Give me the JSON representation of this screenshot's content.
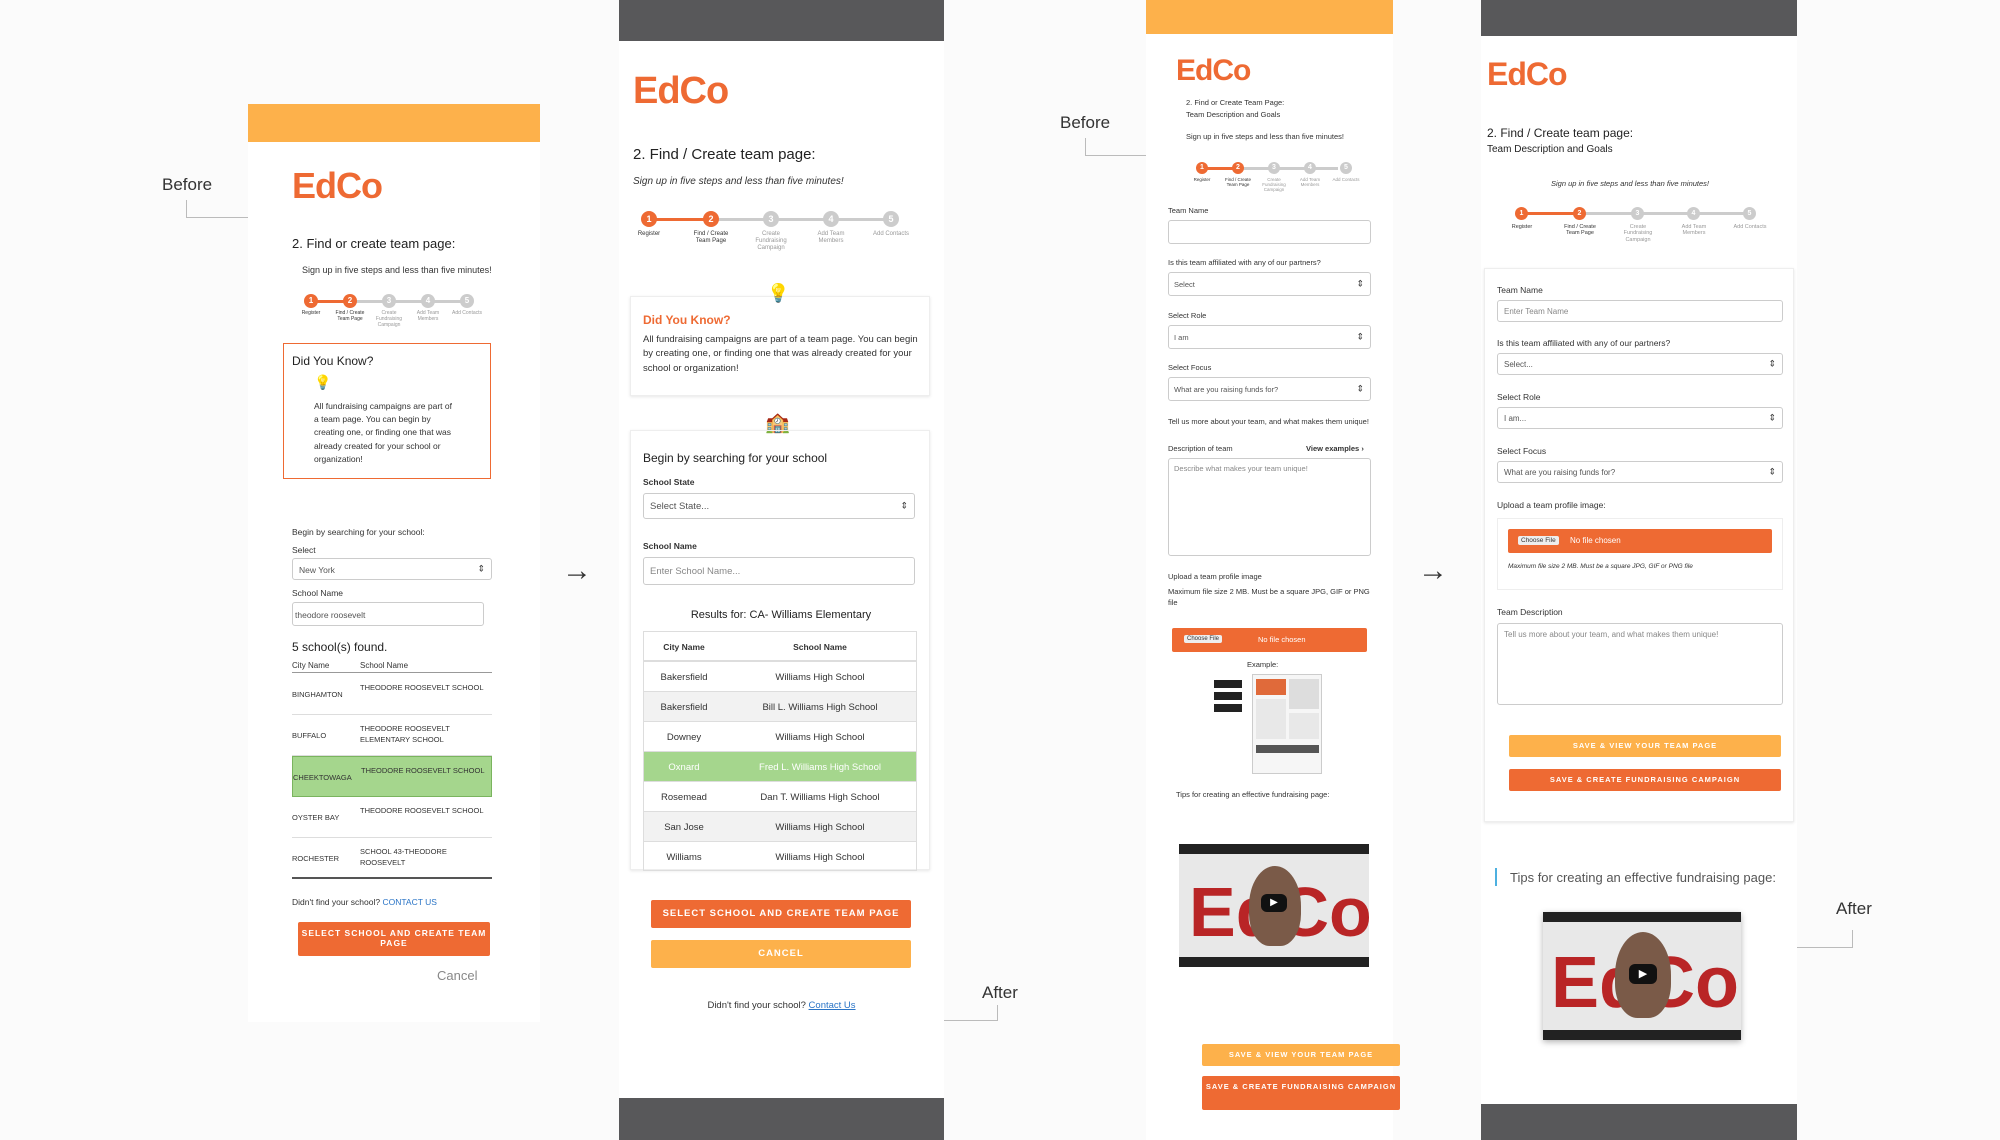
{
  "brand": {
    "logo_text": "EdCo",
    "accent": "#ee6a33",
    "accent_light": "#fdb14b",
    "highlight": "#a5d68d",
    "link": "#2a74c6"
  },
  "annotations": {
    "before1": "Before",
    "before2": "Before",
    "after1": "After",
    "after2": "After"
  },
  "steps": [
    "Register",
    "Find / Create Team Page",
    "Create Fundraising Campaign",
    "Add Team Members",
    "Add Contacts"
  ],
  "p1": {
    "title": "2. Find or create team page:",
    "subtitle": "Sign up in five steps and less than five minutes!",
    "dyk_title": "Did You Know?",
    "dyk_text": "All fundraising campaigns are part of a team page. You can begin by creating one, or finding one that was already created for your school or organization!",
    "search_label": "Begin by searching for your school:",
    "select_label": "Select",
    "state_value": "New York",
    "school_label": "School Name",
    "school_value": "theodore roosevelt",
    "found": "5 school(s) found.",
    "col_city": "City Name",
    "col_school": "School Name",
    "rows": [
      {
        "city": "BINGHAMTON",
        "school": "THEODORE ROOSEVELT SCHOOL"
      },
      {
        "city": "BUFFALO",
        "school": "THEODORE ROOSEVELT ELEMENTARY SCHOOL"
      },
      {
        "city": "CHEEKTOWAGA",
        "school": "THEODORE ROOSEVELT SCHOOL"
      },
      {
        "city": "OYSTER BAY",
        "school": "THEODORE ROOSEVELT SCHOOL"
      },
      {
        "city": "ROCHESTER",
        "school": "SCHOOL 43-THEODORE ROOSEVELT"
      }
    ],
    "not_found": "Didn't find your school?",
    "contact": "CONTACT US",
    "submit": "SELECT SCHOOL AND CREATE TEAM PAGE",
    "cancel": "Cancel"
  },
  "p2": {
    "title": "2. Find / Create team page:",
    "subtitle": "Sign up in five steps and less than five minutes!",
    "dyk_title": "Did You Know?",
    "dyk_text": "All fundraising campaigns are part of a team page. You can begin by creating one, or finding one that was already created for your school or organization!",
    "search_title": "Begin by searching for your school",
    "state_label": "School State",
    "state_placeholder": "Select State...",
    "name_label": "School Name",
    "name_placeholder": "Enter School Name...",
    "results": "Results for: CA- Williams Elementary",
    "col_city": "City Name",
    "col_school": "School Name",
    "rows": [
      {
        "city": "Bakersfield",
        "school": "Williams High School"
      },
      {
        "city": "Bakersfield",
        "school": "Bill L. Williams High School"
      },
      {
        "city": "Downey",
        "school": "Williams High School"
      },
      {
        "city": "Oxnard",
        "school": "Fred L. Williams High School"
      },
      {
        "city": "Rosemead",
        "school": "Dan T. Williams High School"
      },
      {
        "city": "San Jose",
        "school": "Williams High School"
      },
      {
        "city": "Williams",
        "school": "Williams High School"
      }
    ],
    "submit": "SELECT SCHOOL AND CREATE TEAM PAGE",
    "cancel": "CANCEL",
    "not_found": "Didn't find your school?",
    "contact": "Contact Us"
  },
  "p3": {
    "title": "2. Find or Create Team Page:",
    "title2": "Team Description and Goals",
    "subtitle": "Sign up in five steps and less than five minutes!",
    "team_name": "Team Name",
    "affiliated": "Is this team affiliated with any of our partners?",
    "affiliated_value": "Select",
    "role": "Select Role",
    "role_value": "I am",
    "focus": "Select Focus",
    "focus_value": "What are you raising funds for?",
    "tell": "Tell us more about your team, and what makes them unique!",
    "desc_label": "Description of team",
    "view_examples": "View examples",
    "desc_placeholder": "Describe what makes your team unique!",
    "upload": "Upload a team profile image",
    "upload_hint": "Maximum file size 2 MB. Must be a square JPG, GIF or PNG file",
    "choose": "Choose File",
    "no_file": "No file chosen",
    "example": "Example:",
    "tips": "Tips for creating an effective fundraising page:",
    "save_view": "SAVE & VIEW YOUR TEAM PAGE",
    "save_create": "SAVE & CREATE FUNDRAISING CAMPAIGN"
  },
  "p4": {
    "title": "2. Find / Create team page:",
    "title2": "Team Description and Goals",
    "subtitle": "Sign up in five steps and less than five minutes!",
    "team_name": "Team Name",
    "team_placeholder": "Enter Team Name",
    "affiliated": "Is this team affiliated with any of our partners?",
    "affiliated_value": "Select...",
    "role": "Select Role",
    "role_value": "I am...",
    "focus": "Select Focus",
    "focus_value": "What are you raising funds for?",
    "upload": "Upload a team profile image:",
    "choose": "Choose File",
    "no_file": "No file chosen",
    "upload_hint": "Maximum file size 2 MB. Must be a square JPG, GIF or PNG file",
    "team_desc": "Team Description",
    "desc_placeholder": "Tell us more about your team, and what makes them unique!",
    "save_view": "SAVE & VIEW YOUR TEAM PAGE",
    "save_create": "SAVE & CREATE FUNDRAISING CAMPAIGN",
    "tips": "Tips for creating an effective fundraising page:"
  }
}
